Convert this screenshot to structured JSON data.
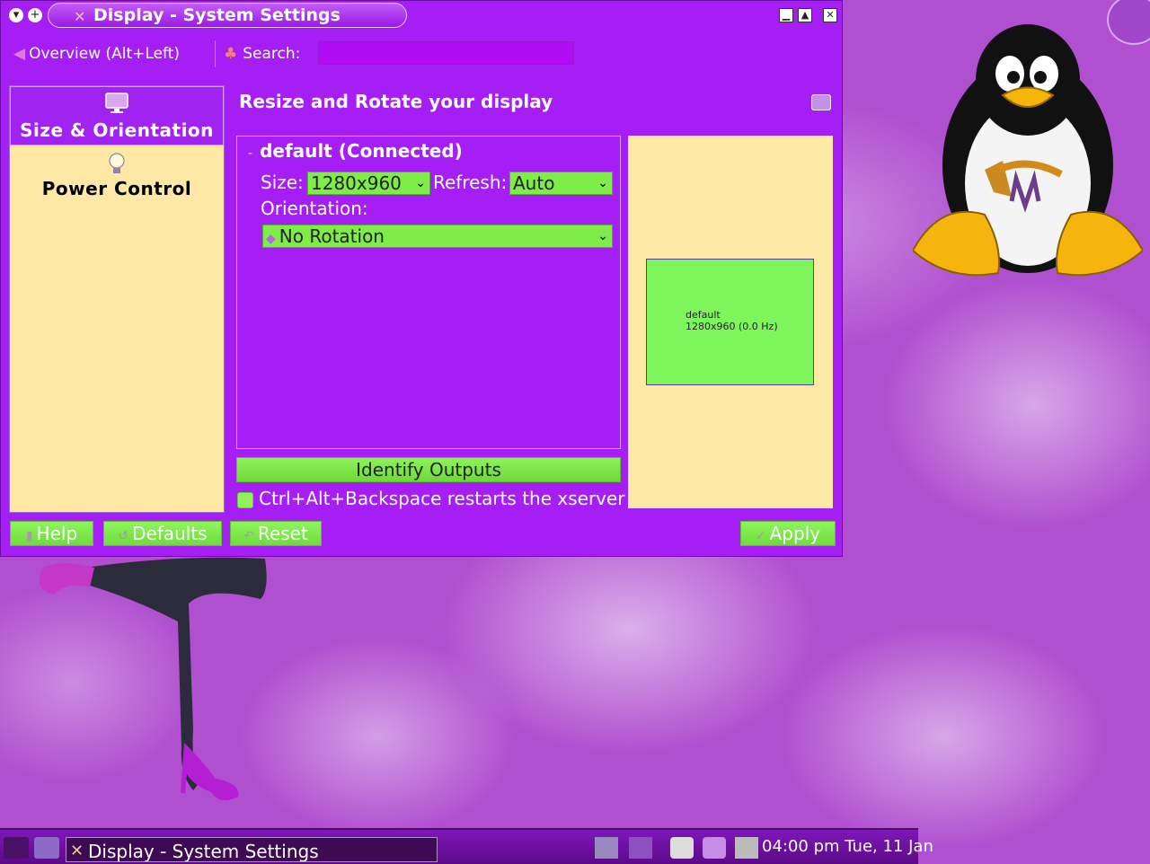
{
  "window": {
    "title": "Display - System Settings"
  },
  "toolbar": {
    "overview_label": "Overview (Alt+Left)",
    "search_label": "Search:",
    "search_value": ""
  },
  "sidebar": {
    "items": [
      {
        "label": "Size & Orientation",
        "selected": true
      },
      {
        "label": "Power Control",
        "selected": false
      }
    ]
  },
  "main": {
    "heading": "Resize and Rotate your display",
    "output_group": {
      "title": "default (Connected)",
      "size_label": "Size:",
      "size_value": "1280x960",
      "refresh_label": "Refresh:",
      "refresh_value": "Auto",
      "orientation_label": "Orientation:",
      "orientation_value": "No Rotation"
    },
    "preview": {
      "output_name": "default",
      "output_mode": "1280x960 (0.0 Hz)"
    },
    "identify_label": "Identify Outputs",
    "checkbox_label": "Ctrl+Alt+Backspace restarts the xserver"
  },
  "buttons": {
    "help": "Help",
    "defaults": "Defaults",
    "reset": "Reset",
    "apply": "Apply"
  },
  "taskbar": {
    "task_title": "Display - System Settings",
    "time": "04:00 pm",
    "date": "Tue, 11 Jan"
  },
  "colors": {
    "window_bg": "#a51ff5",
    "sidebar_bg": "#ffe8a6",
    "accent_green": "#80ec4a"
  }
}
